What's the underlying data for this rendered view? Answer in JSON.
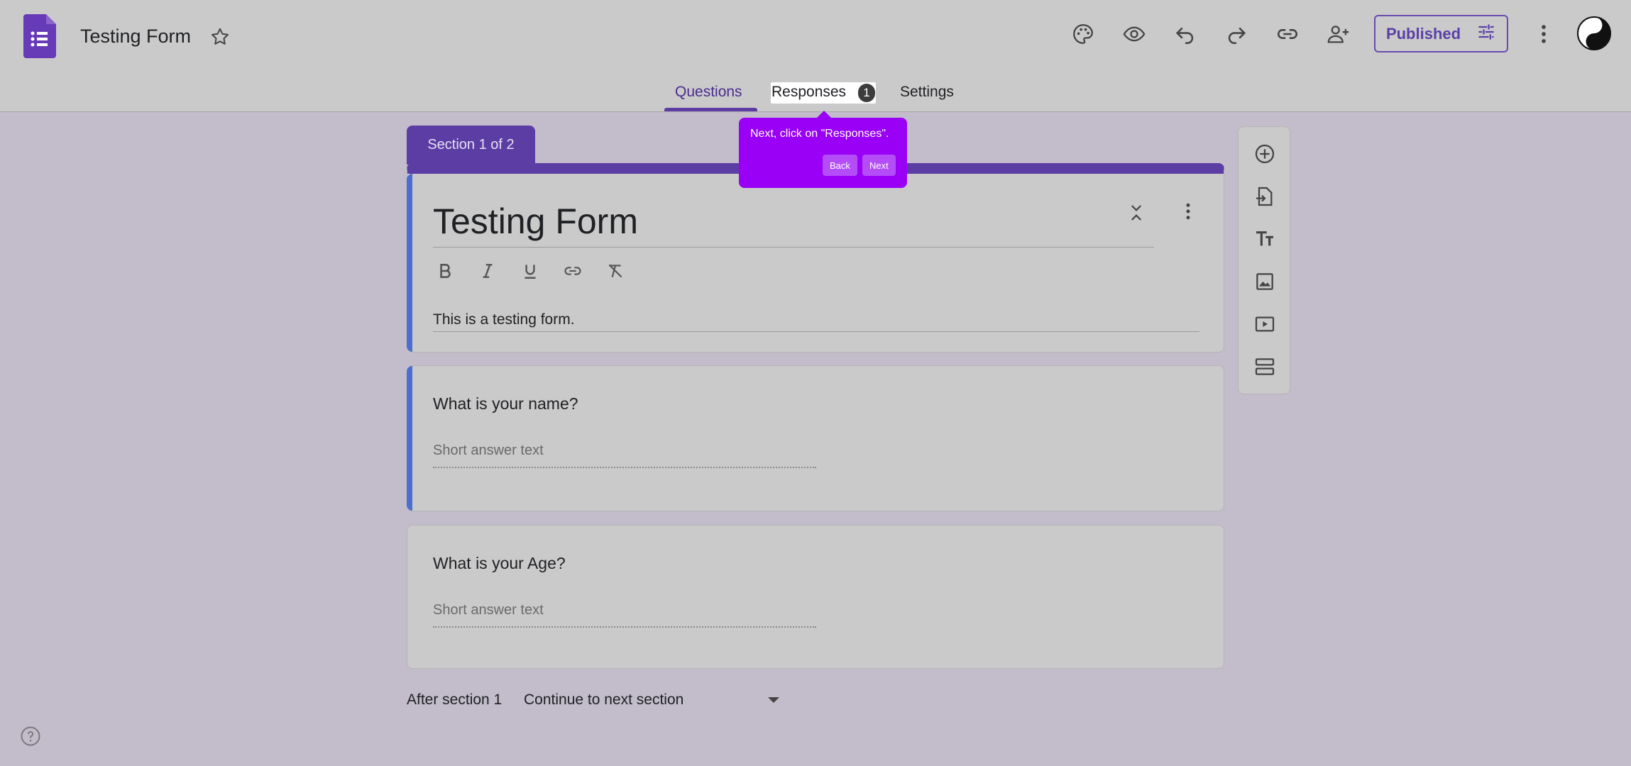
{
  "header": {
    "doc_title": "Testing Form",
    "publish_label": "Published",
    "tabs": [
      {
        "label": "Questions"
      },
      {
        "label": "Responses",
        "badge": "1"
      },
      {
        "label": "Settings"
      }
    ]
  },
  "tooltip": {
    "text": "Next, click on \"Responses\".",
    "back_label": "Back",
    "next_label": "Next"
  },
  "form": {
    "section_label": "Section 1 of 2",
    "title": "Testing Form",
    "description": "This is a testing form.",
    "questions": [
      {
        "title": "What is your name?",
        "placeholder": "Short answer text"
      },
      {
        "title": "What is your Age?",
        "placeholder": "Short answer text"
      }
    ],
    "after_section_label": "After section 1",
    "after_section_value": "Continue to next section"
  },
  "colors": {
    "accent": "#5c3da3",
    "tooltip": "#9900f5",
    "question_accent": "#4a6fd0"
  }
}
